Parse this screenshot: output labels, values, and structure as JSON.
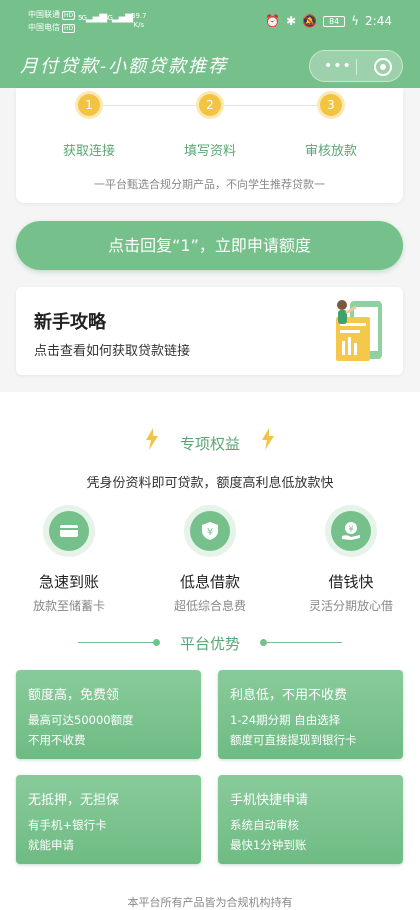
{
  "status_bar": {
    "carrier1": "中国联通",
    "carrier2": "中国电信",
    "hd": "HD",
    "signal1": "5G",
    "signal2": "4G",
    "speed_value": "39.7",
    "speed_unit": "K/s",
    "battery": "84",
    "time": "2:44"
  },
  "header": {
    "title": "月付贷款-小额贷款推荐"
  },
  "steps": {
    "items": [
      {
        "num": "1",
        "label": "获取连接"
      },
      {
        "num": "2",
        "label": "填写资料"
      },
      {
        "num": "3",
        "label": "审核放款"
      }
    ],
    "note": "一平台甄选合规分期产品，不向学生推荐贷款一"
  },
  "main_button": {
    "label": "点击回复“1”，立即申请额度"
  },
  "guide": {
    "title": "新手攻略",
    "subtitle": "点击查看如何获取贷款链接"
  },
  "benefits": {
    "heading": "专项权益",
    "description": "凭身份资料即可贷款，额度高利息低放款快",
    "features": [
      {
        "icon": "card-icon",
        "name": "急速到账",
        "desc": "放款至储蓄卡"
      },
      {
        "icon": "yen-shield-icon",
        "name": "低息借款",
        "desc": "超低综合息费"
      },
      {
        "icon": "yen-hand-icon",
        "name": "借钱快",
        "desc": "灵活分期放心借"
      }
    ]
  },
  "advantages": {
    "heading": "平台优势",
    "cards": [
      {
        "title": "额度高，免费领",
        "line1": "最高可达50000额度",
        "line2": "不用不收费"
      },
      {
        "title": "利息低，不用不收费",
        "line1": "1-24期分期 自由选择",
        "line2": "额度可直接提现到银行卡"
      },
      {
        "title": "无抵押，无担保",
        "line1": "有手机+银行卡",
        "line2": "就能申请"
      },
      {
        "title": "手机快捷申请",
        "line1": "系统自动审核",
        "line2": "最快1分钟到账"
      }
    ]
  },
  "footer": {
    "text": "本平台所有产品皆为合规机构持有"
  },
  "colors": {
    "primary_green": "#76c08b",
    "step_yellow": "#f3c343",
    "text_green": "#5aa676"
  }
}
